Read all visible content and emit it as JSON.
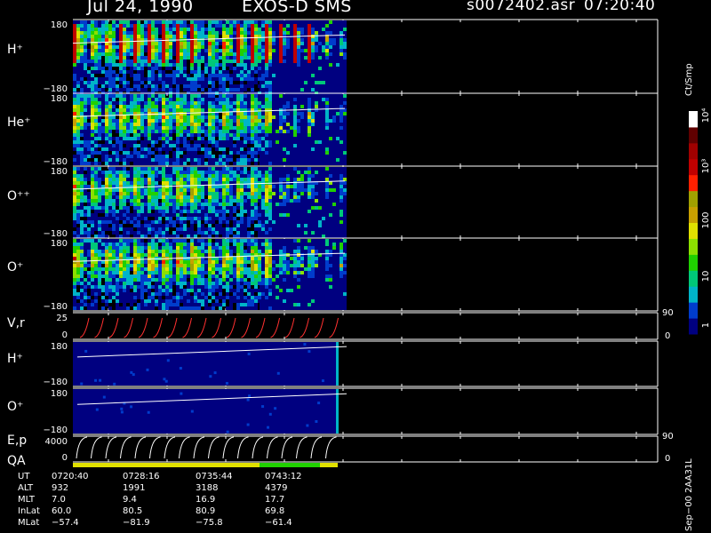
{
  "header": {
    "title_left": "Jul 24, 1990",
    "title_mid": "EXOS-D SMS",
    "file": "s0072402.asr",
    "time": "07:20:40"
  },
  "colorbar": {
    "label": "Ct/Smp",
    "ticks": [
      "1",
      "10",
      "100",
      "10³",
      "10⁴"
    ],
    "colors": [
      "#000080",
      "#003ccc",
      "#00b4c8",
      "#00c878",
      "#20d000",
      "#8ce000",
      "#e0e000",
      "#c8a000",
      "#a0a000",
      "#ff2000",
      "#c00000",
      "#a00000",
      "#600000",
      "#ffffff"
    ]
  },
  "chart_data": {
    "type": "heatmap",
    "panels": [
      {
        "label": "H⁺",
        "ytop": "180",
        "ybot": "−180"
      },
      {
        "label": "He⁺",
        "ytop": "180",
        "ybot": "−180"
      },
      {
        "label": "O⁺⁺",
        "ytop": "180",
        "ybot": "−180"
      },
      {
        "label": "O⁺",
        "ytop": "180",
        "ybot": "−180"
      },
      {
        "label": "V,r",
        "ytop": "25",
        "ybot": "0",
        "right_top": "90",
        "right_bot": "0"
      },
      {
        "label": "H⁺",
        "ytop": "180",
        "ybot": "−180"
      },
      {
        "label": "O⁺",
        "ytop": "180",
        "ybot": "−180"
      },
      {
        "label": "E,p",
        "ytop": "4000",
        "ybot": "0",
        "right_top": "90",
        "right_bot": "0"
      }
    ],
    "qa_label": "QA",
    "ephemeris": {
      "rows": [
        {
          "name": "UT",
          "values": [
            "0720:40",
            "0728:16",
            "0735:44",
            "0743:12"
          ]
        },
        {
          "name": "ALT",
          "values": [
            "932",
            "1991",
            "3188",
            "4379"
          ]
        },
        {
          "name": "MLT",
          "values": [
            "7.0",
            "9.4",
            "16.9",
            "17.7"
          ]
        },
        {
          "name": "InLat",
          "values": [
            "60.0",
            "80.5",
            "80.9",
            "69.8"
          ]
        },
        {
          "name": "MLat",
          "values": [
            "−57.4",
            "−81.9",
            "−75.8",
            "−61.4"
          ]
        }
      ]
    },
    "side_note": "Sep−00 2AA31L"
  }
}
